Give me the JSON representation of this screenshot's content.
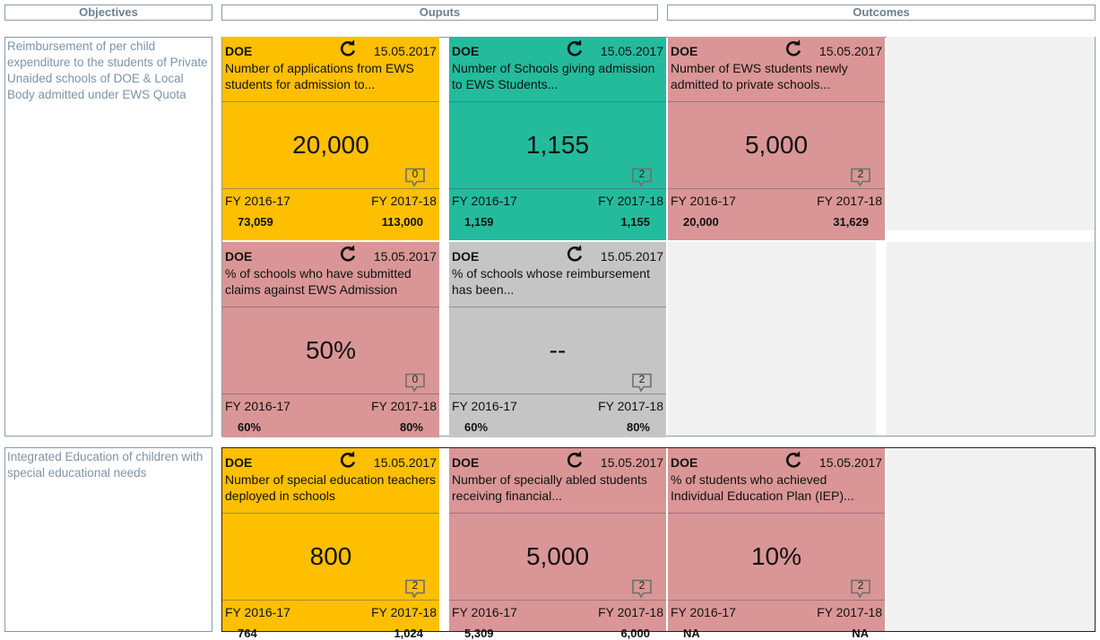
{
  "headers": {
    "objectives": "Objectives",
    "outputs": "Ouputs",
    "outcomes": "Outcomes"
  },
  "colors": {
    "yellow": "#fdbf00",
    "teal": "#24bb9d",
    "pink": "#da9696",
    "gray": "#c5c5c5",
    "empty": "#f1f1f1"
  },
  "rows": [
    {
      "objective": "Reimbursement of per child expenditure to the students of Private Unaided schools of DOE & Local Body admitted under EWS Quota",
      "cards": [
        {
          "dept": "DOE",
          "date": "15.05.2017",
          "desc": "Number of applications from EWS students for admission to...",
          "value": "20,000",
          "comments": "0",
          "fy1": "FY 2016-17",
          "fy2": "FY 2017-18",
          "v1": "73,059",
          "v2": "113,000",
          "color": "#fdbf00"
        },
        {
          "dept": "DOE",
          "date": "15.05.2017",
          "desc": "Number of Schools giving admission to EWS Students...",
          "value": "1,155",
          "comments": "2",
          "fy1": "FY 2016-17",
          "fy2": "FY 2017-18",
          "v1": "1,159",
          "v2": "1,155",
          "color": "#24bb9d"
        },
        {
          "dept": "DOE",
          "date": "15.05.2017",
          "desc": "Number of EWS students newly admitted to private schools...",
          "value": "5,000",
          "comments": "2",
          "fy1": "FY 2016-17",
          "fy2": "FY 2017-18",
          "v1": "20,000",
          "v2": "31,629",
          "color": "#da9696"
        },
        {
          "dept": "DOE",
          "date": "15.05.2017",
          "desc": "% of schools who have submitted claims against EWS Admission",
          "value": "50%",
          "comments": "0",
          "fy1": "FY 2016-17",
          "fy2": "FY 2017-18",
          "v1": "60%",
          "v2": "80%",
          "color": "#da9696"
        },
        {
          "dept": "DOE",
          "date": "15.05.2017",
          "desc": "% of schools whose reimbursement has been...",
          "value": "--",
          "comments": "2",
          "fy1": "FY 2016-17",
          "fy2": "FY 2017-18",
          "v1": "60%",
          "v2": "80%",
          "color": "#c5c5c5"
        }
      ]
    },
    {
      "objective": "Integrated Education of children with special educational needs",
      "cards": [
        {
          "dept": "DOE",
          "date": "15.05.2017",
          "desc": "Number of special education teachers deployed in schools",
          "value": "800",
          "comments": "2",
          "fy1": "FY 2016-17",
          "fy2": "FY 2017-18",
          "v1": "764",
          "v2": "1,024",
          "color": "#fdbf00"
        },
        {
          "dept": "DOE",
          "date": "15.05.2017",
          "desc": "Number of specially abled students receiving financial...",
          "value": "5,000",
          "comments": "2",
          "fy1": "FY 2016-17",
          "fy2": "FY 2017-18",
          "v1": "5,309",
          "v2": "6,000",
          "color": "#da9696"
        },
        {
          "dept": "DOE",
          "date": "15.05.2017",
          "desc": "% of students who achieved Individual Education Plan (IEP)...",
          "value": "10%",
          "comments": "2",
          "fy1": "FY 2016-17",
          "fy2": "FY 2017-18",
          "v1": "NA",
          "v2": "NA",
          "color": "#da9696"
        }
      ]
    }
  ]
}
